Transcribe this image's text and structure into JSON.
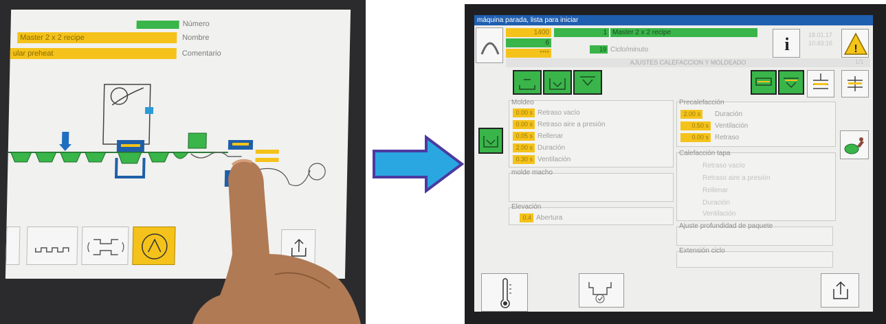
{
  "left": {
    "numero_label": "Número",
    "nombre_value": "Master 2 x 2 recipe",
    "nombre_label": "Nombre",
    "comentario_value": "ular preheat",
    "comentario_label": "Comentario",
    "tabs": [
      "heater-icon",
      "mold-icon",
      "motor-icon"
    ]
  },
  "right": {
    "status": "máquina parada, lista para iniciar",
    "header": {
      "val_1400": "1400",
      "val_1": "1",
      "recipe_name": "Master 2 x 2 recipe",
      "val_6": "6",
      "val_stars": "****",
      "cycles_value": "19",
      "cycles_label": "Ciclo/minuto",
      "date": "18.01.17",
      "time": "10:43:16",
      "section_title": "AJUSTES CALEFACCION Y MOLDEADO",
      "page": "1/1"
    },
    "moldeo": {
      "title": "Moldeo",
      "rows": [
        {
          "value": "0.00 s",
          "label": "Retraso vacío"
        },
        {
          "value": "0.00 s",
          "label": "Retraso aire a presión"
        },
        {
          "value": "0.05 s",
          "label": "Rellenar"
        },
        {
          "value": "2.00 s",
          "label": "Duración"
        },
        {
          "value": "0.30 s",
          "label": "Ventilación"
        }
      ]
    },
    "precalefaccion": {
      "title": "Precalefacción",
      "rows": [
        {
          "value": "2.00 s",
          "label": "Duración"
        },
        {
          "value": "0.50 s",
          "label": "Ventilación"
        },
        {
          "value": "0.00 s",
          "label": "Retraso"
        }
      ]
    },
    "calefaccion_tapa": {
      "title": "Calefacción tapa",
      "rows": [
        "Retraso vacío",
        "Retraso aire a presión",
        "Rellenar",
        "Duración",
        "Ventilación"
      ]
    },
    "molde_macho": {
      "title": "molde macho"
    },
    "elevacion": {
      "title": "Elevación",
      "value": "0.4",
      "label": "Abertura"
    },
    "ajuste": {
      "title": "Ajuste profundidad de paquete"
    },
    "extension": {
      "title": "Extensión ciclo"
    },
    "colors": {
      "accent_green": "#39b54a",
      "field_yellow": "#f4c21a",
      "status_blue": "#1f5fb0",
      "warning": "#f5c518"
    }
  }
}
